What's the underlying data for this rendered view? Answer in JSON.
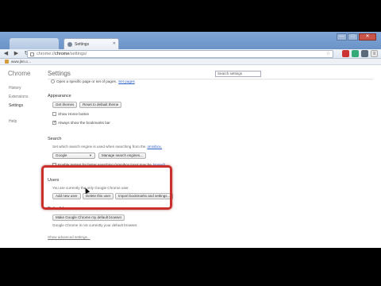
{
  "browser": {
    "tab_prev_title": "",
    "tab_title": "Settings",
    "omnibox": {
      "scheme": "chrome://",
      "host": "chrome",
      "path": "/settings/"
    },
    "bookmark_label": "www.jkm.c...",
    "window_controls": [
      "—",
      "□",
      "✕"
    ]
  },
  "sidebar": {
    "brand": "Chrome",
    "items": [
      "History",
      "Extensions",
      "Settings",
      "Help"
    ],
    "active": "Settings"
  },
  "settings": {
    "title": "Settings",
    "search_placeholder": "Search settings",
    "startup_text": "Open a specific page or set of pages.",
    "startup_link": "Set pages",
    "appearance": {
      "title": "Appearance",
      "get_themes": "Get themes",
      "reset_theme": "Reset to default theme",
      "show_home": "Show Home button",
      "show_bookmarks": "Always show the bookmarks bar"
    },
    "search": {
      "title": "Search",
      "desc": "Set which search engine is used when searching from the",
      "desc_link": "omnibox.",
      "engine": "Google",
      "manage": "Manage search engines...",
      "instant": "Enable Instant for faster searching (omnibox input may be",
      "instant_link": "logged)"
    },
    "users": {
      "title": "Users",
      "desc": "You are currently the only Google Chrome user.",
      "add": "Add new user",
      "delete": "Delete this user",
      "import": "Import bookmarks and settings..."
    },
    "default_browser": {
      "title": "Default browser",
      "make_default": "Make Google Chrome my default browser",
      "desc": "Google Chrome is not currently your default browser."
    },
    "advanced_link": "Show advanced settings..."
  },
  "colors": {
    "highlight": "#c9302c",
    "link": "#2b5fc3"
  }
}
